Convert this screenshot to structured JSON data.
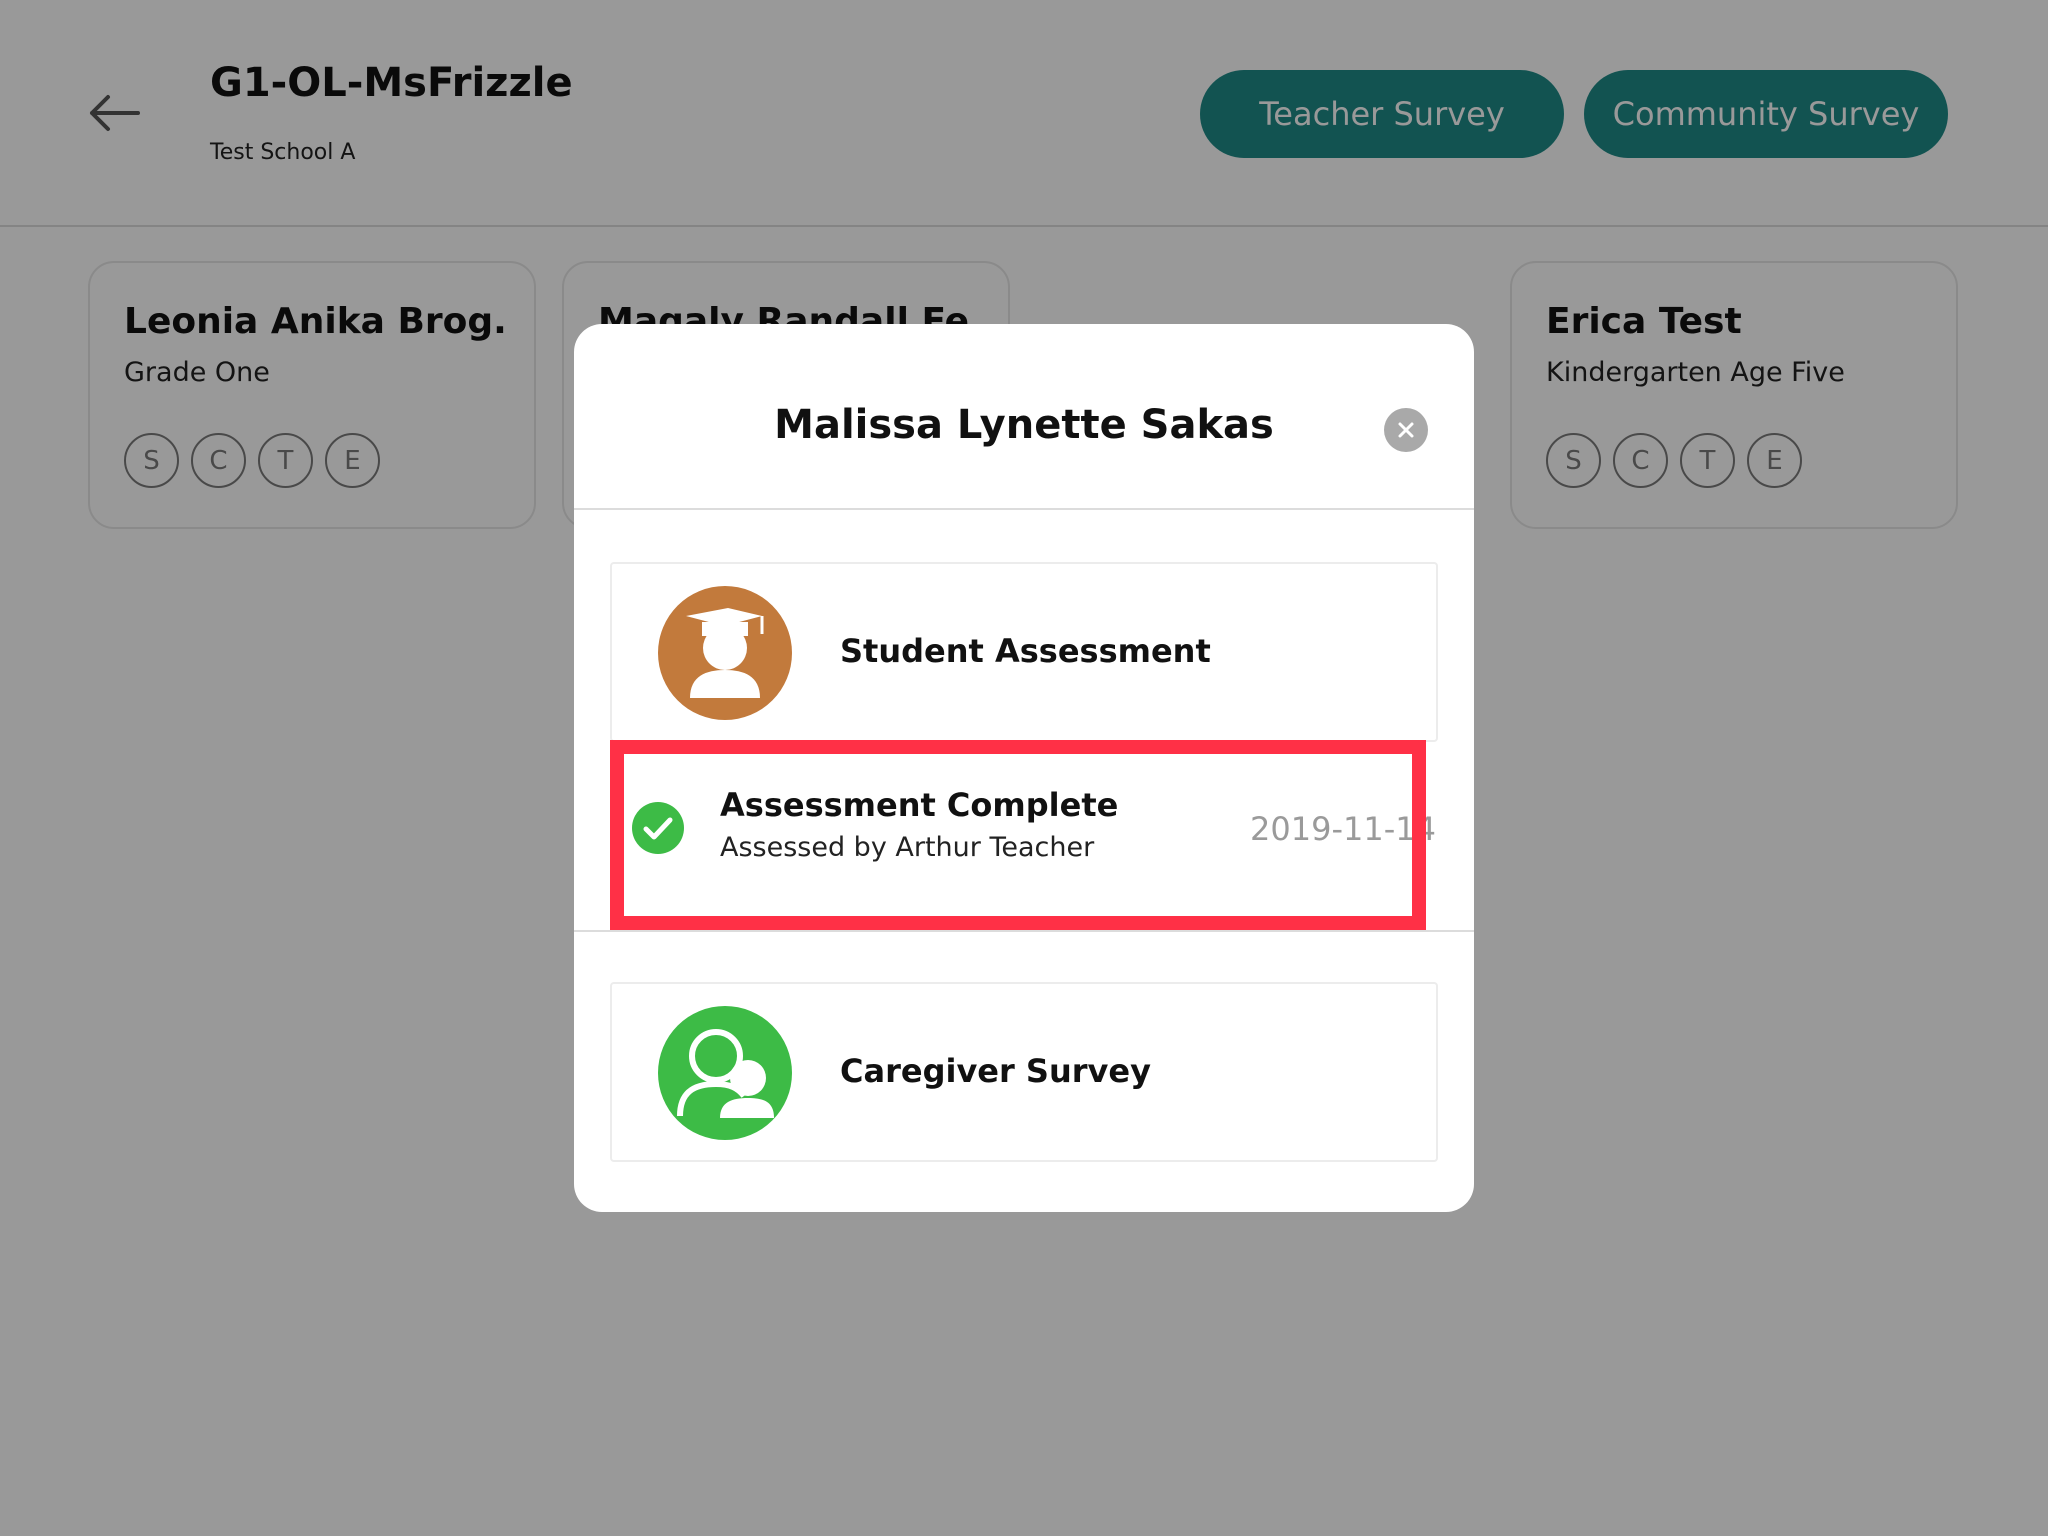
{
  "header": {
    "class_title": "G1-OL-MsFrizzle",
    "school_name": "Test School A",
    "teacher_survey_label": "Teacher Survey",
    "community_survey_label": "Community Survey"
  },
  "students": [
    {
      "name": "Leonia Anika Brog...",
      "grade": "Grade One",
      "badges": [
        "S",
        "C",
        "T",
        "E"
      ]
    },
    {
      "name": "Magaly Randall Fe...",
      "grade": "",
      "badges": []
    },
    {
      "name": "Erica Test",
      "grade": "Kindergarten Age Five",
      "badges": [
        "S",
        "C",
        "T",
        "E"
      ]
    }
  ],
  "modal": {
    "title": "Malissa Lynette Sakas",
    "student_assessment": {
      "label": "Student Assessment",
      "icon": "graduate-student-icon",
      "color": "#c27a3c"
    },
    "result": {
      "title": "Assessment Complete",
      "subtitle": "Assessed by Arthur Teacher",
      "date": "2019-11-14",
      "icon": "check-circle-icon",
      "color": "#3dbb46"
    },
    "caregiver_survey": {
      "label": "Caregiver Survey",
      "icon": "caregiver-people-icon",
      "color": "#3dbb46"
    }
  },
  "colors": {
    "accent": "#1f8a88",
    "highlight": "#ff3046"
  }
}
